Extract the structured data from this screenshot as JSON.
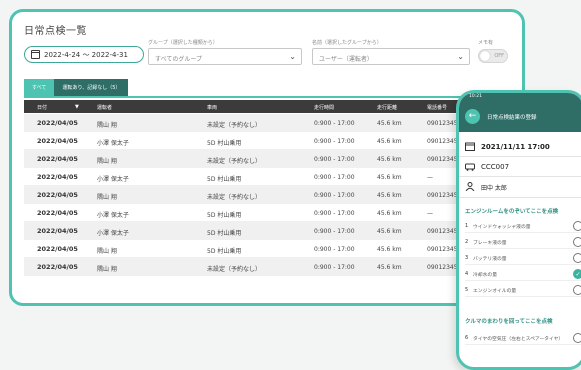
{
  "window": {
    "title": "日常点検一覧"
  },
  "filters": {
    "date_range": "2022-4-24 〜 2022-4-31",
    "group_label": "グループ（選択した種類から）",
    "group_value": "すべてのグループ",
    "name_label": "名前（選択したグループから）",
    "name_value": "ユーザー（運転者）",
    "memo_label": "メモ有",
    "toggle_value": "OFF"
  },
  "tabs": [
    {
      "label": "すべて"
    },
    {
      "label": "運転あり、記録なし（5）"
    }
  ],
  "table": {
    "columns": [
      "日付",
      "運転者",
      "車両",
      "走行時間",
      "走行距離",
      "電話番号"
    ],
    "rows": [
      [
        "2022/04/05",
        "隅山 翔",
        "未設定（予約なし）",
        "0:900 - 17:00",
        "45.6 km",
        "090123456"
      ],
      [
        "2022/04/05",
        "小澤 保太子",
        "5D 村山乗用",
        "0:900 - 17:00",
        "45.6 km",
        "090123456"
      ],
      [
        "2022/04/05",
        "隅山 翔",
        "未設定（予約なし）",
        "0:900 - 17:00",
        "45.6 km",
        "090123456"
      ],
      [
        "2022/04/05",
        "小澤 保太子",
        "5D 村山乗用",
        "0:900 - 17:00",
        "45.6 km",
        "—"
      ],
      [
        "2022/04/05",
        "隅山 翔",
        "未設定（予約なし）",
        "0:900 - 17:00",
        "45.6 km",
        "090123456"
      ],
      [
        "2022/04/05",
        "小澤 保太子",
        "5D 村山乗用",
        "0:900 - 17:00",
        "45.6 km",
        "—"
      ],
      [
        "2022/04/05",
        "小澤 保太子",
        "5D 村山乗用",
        "0:900 - 17:00",
        "45.6 km",
        "090123456"
      ],
      [
        "2022/04/05",
        "隅山 翔",
        "5D 村山乗用",
        "0:900 - 17:00",
        "45.6 km",
        "090123456"
      ],
      [
        "2022/04/05",
        "隅山 翔",
        "未設定（予約なし）",
        "0:900 - 17:00",
        "45.6 km",
        "090123456"
      ]
    ]
  },
  "phone": {
    "time": "10:21",
    "title": "日常点検結果の登録",
    "datetime": "2021/11/11 17:00",
    "vehicle": "CCC007",
    "driver": "田中 太郎",
    "section1": "エンジンルームをのぞいてここを点検",
    "items": [
      {
        "n": "1",
        "label": "ウインドウォッシャ液の量",
        "checked": false
      },
      {
        "n": "2",
        "label": "ブレーキ液の量",
        "checked": false
      },
      {
        "n": "3",
        "label": "バッテリ液の量",
        "checked": false
      },
      {
        "n": "4",
        "label": "冷却水の量",
        "checked": true
      },
      {
        "n": "5",
        "label": "エンジンオイルの量",
        "checked": false
      }
    ],
    "section2": "クルマのまわりを回ってここを点検",
    "item6": {
      "n": "6",
      "label": "タイヤの空気圧（左右とスペアータイヤ）"
    },
    "colors": {
      "accent": "#4fc3b1",
      "header": "#2f6e67",
      "check": "#3cb39f"
    }
  }
}
